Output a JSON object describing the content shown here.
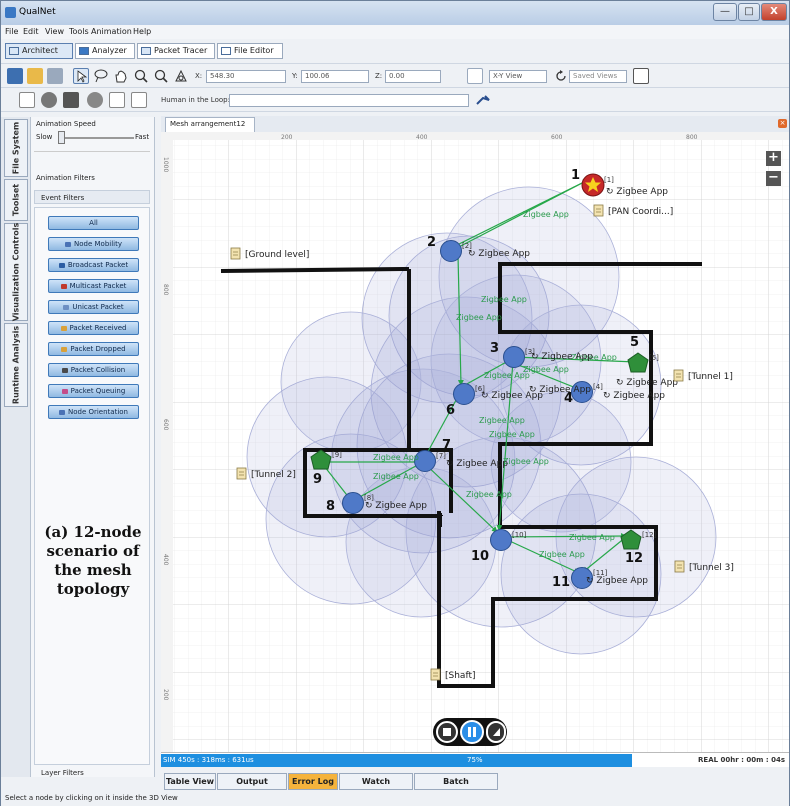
{
  "window": {
    "title": "QualNet",
    "minimize": "—",
    "maximize": "□",
    "close": "X"
  },
  "menu": [
    "File",
    "Edit",
    "View",
    "Tools",
    "Animation",
    "Help"
  ],
  "toolbar": {
    "tabs": [
      "Architect",
      "Analyzer",
      "Packet Tracer",
      "File Editor"
    ],
    "x_label": "X:",
    "x_value": "548.30",
    "y_label": "Y:",
    "y_value": "100.06",
    "z_label": "Z:",
    "z_value": "0.00",
    "view_select": "X-Y View",
    "saved_views": "Saved Views",
    "hitl_label": "Human in the Loop:"
  },
  "sidebar": {
    "vertical_tabs": [
      "File System",
      "Toolset",
      "Visualization Controls",
      "Runtime Analysis"
    ],
    "animation_speed": "Animation Speed",
    "slow": "Slow",
    "fast": "Fast",
    "animation_filters": "Animation Filters",
    "event_filters": "Event Filters",
    "filters": [
      "All",
      "Node Mobility",
      "Broadcast Packet",
      "Multicast Packet",
      "Unicast Packet",
      "Packet Received",
      "Packet Dropped",
      "Packet Collision",
      "Packet Queuing",
      "Node Orientation"
    ],
    "filter_colors": [
      "#3f79b9",
      "#4a72b5",
      "#2c5da3",
      "#c0392b",
      "#6d8fc3",
      "#d9a13a",
      "#d9a13a",
      "#4a4a4a",
      "#c44d8a",
      "#4a72b5"
    ],
    "layer_filters": "Layer Filters"
  },
  "caption": {
    "line1": "(a) 12-node",
    "line2": "scenario of",
    "line3": "the mesh",
    "line4": "topology"
  },
  "canvas": {
    "doc_tab": "Mesh arrangement12",
    "ruler_x": [
      "200",
      "400",
      "600",
      "800"
    ],
    "ruler_y": [
      "1000",
      "800",
      "600",
      "400",
      "200"
    ],
    "labels": {
      "ground": "[Ground level]",
      "tunnel1": "[Tunnel 1]",
      "tunnel2": "[Tunnel 2]",
      "tunnel3": "[Tunnel 3]",
      "shaft": "[Shaft]",
      "pan": "[PAN Coordi...]"
    },
    "app_label": "Zigbee App",
    "nodes": [
      {
        "num": "1",
        "tag": "[1]"
      },
      {
        "num": "2",
        "tag": "[2]"
      },
      {
        "num": "3",
        "tag": "[3]"
      },
      {
        "num": "4",
        "tag": "[4]"
      },
      {
        "num": "5",
        "tag": "[5]"
      },
      {
        "num": "6",
        "tag": "[6]"
      },
      {
        "num": "7",
        "tag": "[7]"
      },
      {
        "num": "8",
        "tag": "[8]"
      },
      {
        "num": "9",
        "tag": "[9]"
      },
      {
        "num": "10",
        "tag": "[10]"
      },
      {
        "num": "11",
        "tag": "[11]"
      },
      {
        "num": "12",
        "tag": "[12]"
      }
    ]
  },
  "status": {
    "sim": "SIM 450s : 318ms : 631us",
    "progress_pct": "75%",
    "progress_fraction": 0.75,
    "real": "REAL 00hr : 00m : 04s"
  },
  "bottom_tabs": [
    "Table View",
    "Output Window",
    "Error Log",
    "Watch Variables",
    "Batch Experiments"
  ],
  "footer": "Select a node by clicking on it inside the 3D View"
}
